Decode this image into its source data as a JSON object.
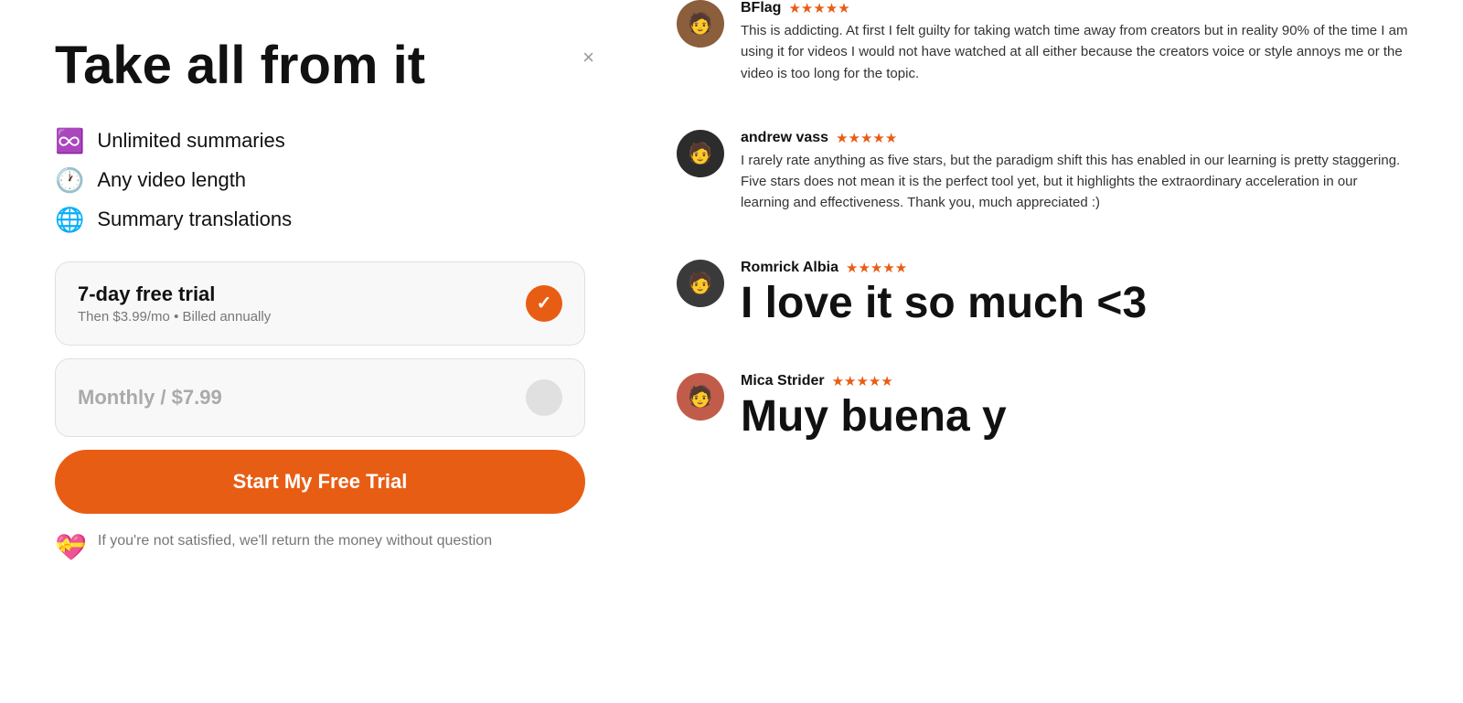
{
  "left": {
    "title": "Take all from it",
    "close_label": "×",
    "features": [
      {
        "icon": "♾️",
        "text": "Unlimited summaries"
      },
      {
        "icon": "🕐",
        "text": "Any video length"
      },
      {
        "icon": "🌐",
        "text": "Summary translations"
      }
    ],
    "plans": [
      {
        "id": "annual",
        "title": "7-day free trial",
        "subtitle": "Then $3.99/mo • Billed annually",
        "selected": true
      },
      {
        "id": "monthly",
        "title": "Monthly / $7.99",
        "subtitle": "",
        "selected": false
      }
    ],
    "cta_label": "Start My Free Trial",
    "guarantee_text": "If you're not satisfied, we'll return the money without question"
  },
  "right": {
    "reviews": [
      {
        "id": "bflag",
        "name": "BFlag",
        "stars": "★★★★★",
        "avatar_label": "👤",
        "text": "This is addicting. At first I felt guilty for taking watch time away from creators but in reality 90% of the time I am using it for videos I would not have watched at all either because the creators voice or style annoys me or the video is too long for the topic.",
        "large": false
      },
      {
        "id": "andrew",
        "name": "andrew vass",
        "stars": "★★★★★",
        "avatar_label": "👤",
        "text": "I rarely rate anything as five stars, but the paradigm shift this has enabled in our learning is pretty staggering. Five stars does not mean it is the perfect tool yet, but it highlights the extraordinary acceleration in our learning and effectiveness. Thank you, much appreciated :)",
        "large": false
      },
      {
        "id": "romrick",
        "name": "Romrick Albia",
        "stars": "★★★★★",
        "avatar_label": "👤",
        "text": "I love it so much <3",
        "large": true
      },
      {
        "id": "mica",
        "name": "Mica Strider",
        "stars": "★★★★★",
        "avatar_label": "👤",
        "text": "Muy buena y",
        "large": true
      }
    ]
  }
}
